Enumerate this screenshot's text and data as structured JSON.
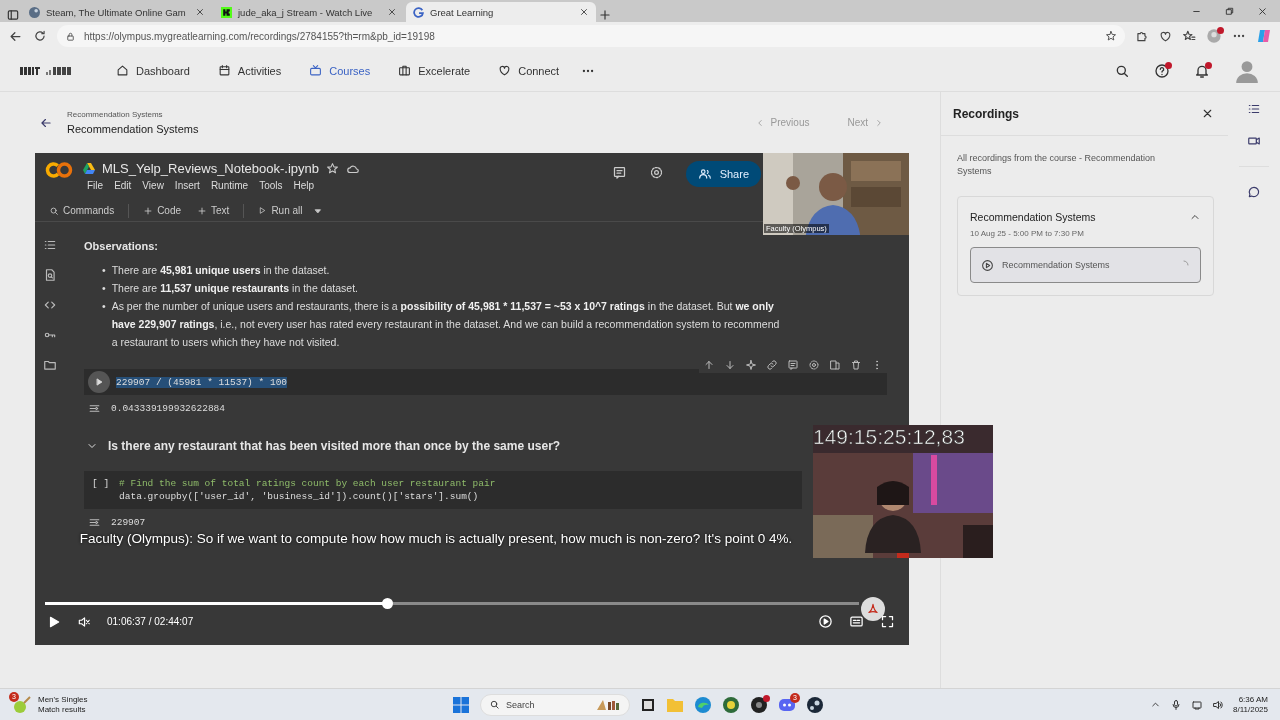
{
  "browser": {
    "tabs": [
      {
        "title": "Steam, The Ultimate Online Gam",
        "kind": "steam",
        "selected": false
      },
      {
        "title": "jude_aka_j Stream - Watch Live",
        "kind": "kick",
        "selected": false
      },
      {
        "title": "Great Learning",
        "kind": "google",
        "selected": true
      }
    ],
    "url": "https://olympus.mygreatlearning.com/recordings/2784155?th=rm&pb_id=19198"
  },
  "nav": {
    "items": [
      {
        "label": "Dashboard",
        "kind": "home",
        "selected": false
      },
      {
        "label": "Activities",
        "kind": "calendar",
        "selected": false
      },
      {
        "label": "Courses",
        "kind": "tv",
        "selected": true
      },
      {
        "label": "Excelerate",
        "kind": "briefcase",
        "selected": false
      },
      {
        "label": "Connect",
        "kind": "heart",
        "selected": false
      }
    ]
  },
  "page": {
    "breadcrumb": "Recommendation Systems",
    "title": "Recommendation Systems",
    "previous": "Previous",
    "next": "Next"
  },
  "notebook": {
    "filename": "MLS_Yelp_Reviews_Notebook-.ipynb",
    "menu": [
      "File",
      "Edit",
      "View",
      "Insert",
      "Runtime",
      "Tools",
      "Help"
    ],
    "share": "Share",
    "toolbar": [
      {
        "label": "Commands",
        "kind": "search"
      },
      {
        "label": "Code",
        "kind": "add"
      },
      {
        "label": "Text",
        "kind": "add"
      },
      {
        "label": "Run all",
        "kind": "run"
      }
    ],
    "heading": "Observations:",
    "marker": "•",
    "bullets": [
      [
        {
          "text": "There are ",
          "bold": false
        },
        {
          "text": "45,981 unique users",
          "bold": true
        },
        {
          "text": " in the dataset.",
          "bold": false
        }
      ],
      [
        {
          "text": "There are ",
          "bold": false
        },
        {
          "text": "11,537 unique restaurants",
          "bold": true
        },
        {
          "text": " in the dataset.",
          "bold": false
        }
      ],
      [
        {
          "text": "As per the number of unique users and restaurants, there is a ",
          "bold": false
        },
        {
          "text": "possibility of 45,981 * 11,537 = ~53 x 10^7 ratings",
          "bold": true
        },
        {
          "text": " in the dataset. But ",
          "bold": false
        },
        {
          "text": "we only have 229,907 ratings",
          "bold": true
        },
        {
          "text": ", i.e., not every user has rated every restaurant in the dataset. And we can build a recommendation system to recommend a restaurant to users which they have not visited.",
          "bold": false
        }
      ]
    ],
    "cell1": {
      "code": "229907 / (45981 * 11537) * 100",
      "text_selected": true,
      "output": "0.043339199932622884"
    },
    "section": {
      "title": "Is there any restaurant that has been visited more than once by the same user?",
      "expanded": true
    },
    "cell2": {
      "prompt": "[ ]",
      "lines": [
        {
          "text": "# Find the sum of total ratings count by each user restaurant pair",
          "kind": "comment"
        },
        {
          "text": "data.groupby(['user_id', 'business_id']).count()['stars'].sum()",
          "kind": "code"
        }
      ],
      "output": "229907"
    }
  },
  "video": {
    "faculty_label": "Faculty (Olympus)",
    "caption": "Faculty (Olympus): So if we want to compute how how much is actually present, how much is non-zero? It's point 0 4%.",
    "time": "01:06:37 / 02:44:07",
    "level": 0.42
  },
  "stream_overlay": {
    "timer": "149:15:25:12,83"
  },
  "recordings": {
    "title": "Recordings",
    "description": "All recordings from the course - Recommendation Systems",
    "group": {
      "title": "Recommendation Systems",
      "date": "10 Aug 25  -  5:00 PM to 7:30 PM",
      "expanded": true,
      "items": [
        {
          "title": "Recommendation Systems",
          "selected": true
        }
      ]
    }
  },
  "taskbar": {
    "widget_title": "Men's Singles",
    "widget_subtitle": "Match results",
    "widget_badge": "3",
    "search": "Search",
    "discord_badge": "3",
    "time": "6:36 AM",
    "date": "8/11/2025"
  }
}
